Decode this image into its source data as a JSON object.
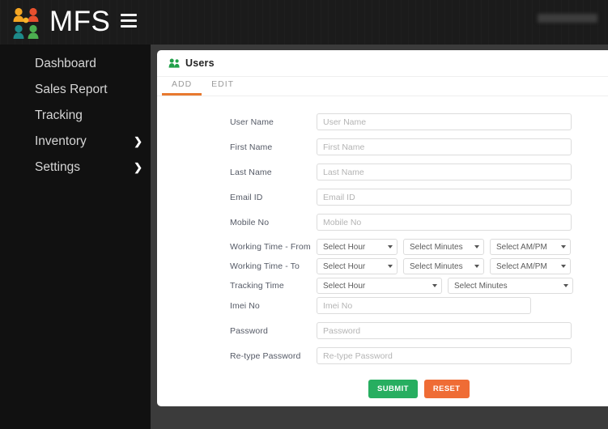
{
  "header": {
    "brand_text": "MFS",
    "logo_icon": "mfs-people-logo",
    "menu_icon": "hamburger-icon",
    "user_chip_text": "",
    "logo_colors": {
      "orange": "#f5a623",
      "red": "#e8502e",
      "teal": "#1d8a8a",
      "green": "#4caf50",
      "yellow": "#f7b32b"
    }
  },
  "sidebar": {
    "items": [
      {
        "label": "Dashboard",
        "has_chevron": false,
        "icon": "chevron-right-icon"
      },
      {
        "label": "Sales Report",
        "has_chevron": false,
        "icon": "chevron-right-icon"
      },
      {
        "label": "Tracking",
        "has_chevron": false,
        "icon": "chevron-right-icon"
      },
      {
        "label": "Inventory",
        "has_chevron": true,
        "icon": "chevron-right-icon"
      },
      {
        "label": "Settings",
        "has_chevron": true,
        "icon": "chevron-right-icon"
      }
    ],
    "chevron_glyph": "❯"
  },
  "panel": {
    "title": "Users",
    "title_icon": "users-icon",
    "tabs": [
      {
        "label": "ADD",
        "active": true
      },
      {
        "label": "EDIT",
        "active": false
      }
    ],
    "accent_color": "#e8792f"
  },
  "form": {
    "fields": {
      "user_name": {
        "label": "User Name",
        "placeholder": "User Name",
        "value": ""
      },
      "first_name": {
        "label": "First Name",
        "placeholder": "First Name",
        "value": ""
      },
      "last_name": {
        "label": "Last Name",
        "placeholder": "Last Name",
        "value": ""
      },
      "email_id": {
        "label": "Email ID",
        "placeholder": "Email ID",
        "value": ""
      },
      "mobile_no": {
        "label": "Mobile No",
        "placeholder": "Mobile No",
        "value": ""
      },
      "imei_no": {
        "label": "Imei No",
        "placeholder": "Imei No",
        "value": ""
      },
      "password": {
        "label": "Password",
        "placeholder": "Password",
        "value": ""
      },
      "retype_password": {
        "label": "Re-type Password",
        "placeholder": "Re-type Password",
        "value": ""
      }
    },
    "working_time_from": {
      "label": "Working Time - From",
      "hour": "Select Hour",
      "minutes": "Select Minutes",
      "ampm": "Select AM/PM"
    },
    "working_time_to": {
      "label": "Working Time - To",
      "hour": "Select Hour",
      "minutes": "Select Minutes",
      "ampm": "Select AM/PM"
    },
    "tracking_time": {
      "label": "Tracking Time",
      "hour": "Select Hour",
      "minutes": "Select Minutes"
    },
    "buttons": {
      "submit": "SUBMIT",
      "reset": "RESET",
      "submit_color": "#27ae60",
      "reset_color": "#ef6c35"
    }
  }
}
